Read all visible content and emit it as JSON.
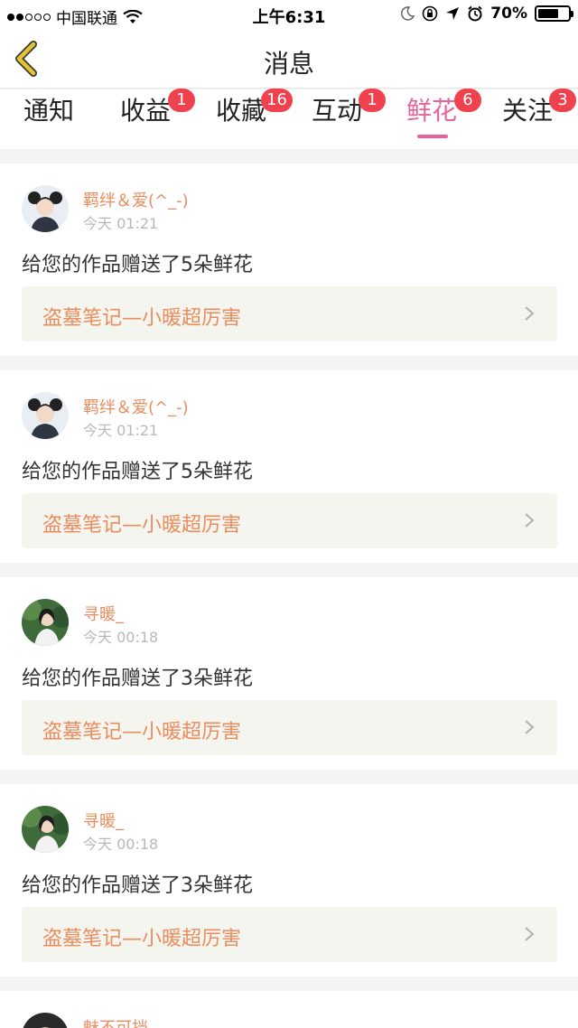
{
  "status_bar": {
    "carrier": "中国联通",
    "time": "上午6:31",
    "battery": "70%",
    "battery_level": 0.7
  },
  "header": {
    "title": "消息",
    "back_icon": "chevron-left-icon"
  },
  "tabs": [
    {
      "label": "通知",
      "badge": ""
    },
    {
      "label": "收益",
      "badge": "1"
    },
    {
      "label": "收藏",
      "badge": "16"
    },
    {
      "label": "互动",
      "badge": "1"
    },
    {
      "label": "鲜花",
      "badge": "6",
      "active": true
    },
    {
      "label": "关注",
      "badge": "3"
    }
  ],
  "messages": [
    {
      "user": "羁绊＆爱(^_-)",
      "time": "今天 01:21",
      "text": "给您的作品赠送了5朵鲜花",
      "work": "盗墓笔记—小暖超厉害"
    },
    {
      "user": "羁绊＆爱(^_-)",
      "time": "今天 01:21",
      "text": "给您的作品赠送了5朵鲜花",
      "work": "盗墓笔记—小暖超厉害"
    },
    {
      "user": "寻暖_",
      "time": "今天 00:18",
      "text": "给您的作品赠送了3朵鲜花",
      "work": "盗墓笔记—小暖超厉害"
    },
    {
      "user": "寻暖_",
      "time": "今天 00:18",
      "text": "给您的作品赠送了3朵鲜花",
      "work": "盗墓笔记—小暖超厉害"
    },
    {
      "user": "魅不可挡"
    }
  ],
  "colors": {
    "accent": "#e5649c",
    "username": "#ea8c5e",
    "badge": "#f0414f",
    "back_arrow": "#e2c33a"
  }
}
